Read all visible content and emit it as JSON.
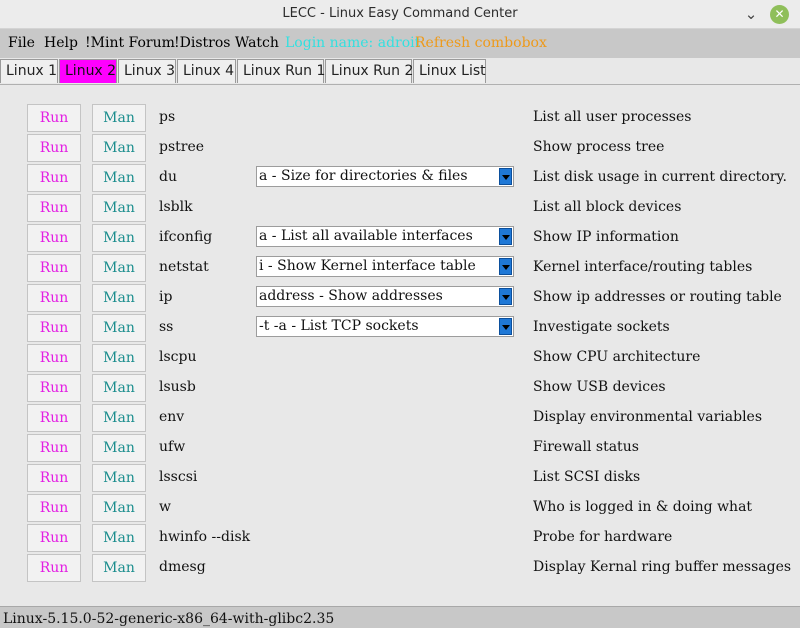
{
  "window": {
    "title": "LECC - Linux Easy Command Center",
    "minimize_glyph": "⌄",
    "close_glyph": "✕",
    "close_color": "#8fbf5a"
  },
  "menu": {
    "items": [
      "File",
      "Help",
      "!Mint Forum",
      "!Distros Watch"
    ],
    "login_label": "Login name: adroit",
    "login_color": "#33e0e0",
    "refresh_label": "Refresh combobox",
    "refresh_color": "#ee9a1a"
  },
  "tabs": {
    "items": [
      "Linux 1",
      "Linux 2",
      "Linux 3",
      "Linux 4",
      "Linux Run 1",
      "Linux Run 2",
      "Linux List"
    ],
    "active": "Linux 2",
    "active_color": "#ff00ff"
  },
  "buttons": {
    "run_label": "Run",
    "man_label": "Man",
    "run_color": "#e31de3",
    "man_color": "#1c8e8e"
  },
  "commands": [
    {
      "cmd": "ps",
      "combo": "",
      "desc": "List all user processes"
    },
    {
      "cmd": "pstree",
      "combo": "",
      "desc": "Show process tree"
    },
    {
      "cmd": "du",
      "combo": "a - Size for directories & files",
      "desc": "List disk usage in current directory."
    },
    {
      "cmd": "lsblk",
      "combo": "",
      "desc": "List all block devices"
    },
    {
      "cmd": "ifconfig",
      "combo": "a - List all available interfaces",
      "desc": "Show IP information"
    },
    {
      "cmd": "netstat",
      "combo": "i - Show Kernel interface table",
      "desc": "Kernel interface/routing tables"
    },
    {
      "cmd": "ip",
      "combo": "address - Show addresses",
      "desc": "Show ip addresses or routing table"
    },
    {
      "cmd": "ss",
      "combo": "-t -a - List TCP sockets",
      "desc": "Investigate sockets"
    },
    {
      "cmd": "lscpu",
      "combo": "",
      "desc": "Show CPU architecture"
    },
    {
      "cmd": "lsusb",
      "combo": "",
      "desc": "Show USB devices"
    },
    {
      "cmd": "env",
      "combo": "",
      "desc": "Display environmental variables"
    },
    {
      "cmd": "ufw",
      "combo": "",
      "desc": "Firewall status"
    },
    {
      "cmd": "lsscsi",
      "combo": "",
      "desc": "List SCSI disks"
    },
    {
      "cmd": "w",
      "combo": "",
      "desc": "Who is logged in & doing what"
    },
    {
      "cmd": "hwinfo --disk",
      "combo": "",
      "desc": "Probe for hardware"
    },
    {
      "cmd": "dmesg",
      "combo": "",
      "desc": "Display Kernal ring buffer messages"
    }
  ],
  "status": {
    "text": "Linux-5.15.0-52-generic-x86_64-with-glibc2.35"
  }
}
